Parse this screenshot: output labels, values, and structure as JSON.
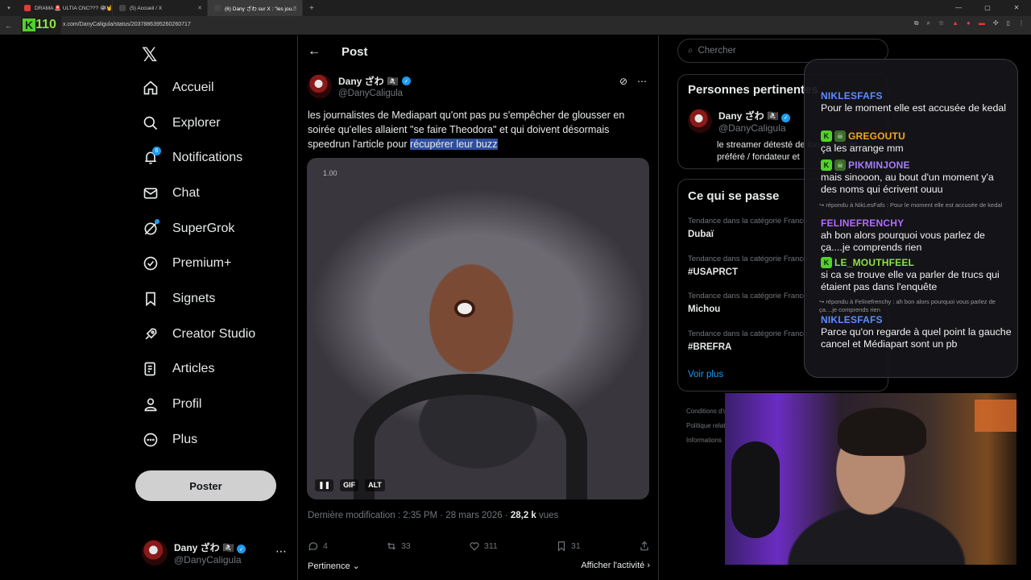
{
  "browser": {
    "tabs": [
      {
        "title": "DRAMA 🚨 ULTIA CNC??? 😭🤘",
        "favicon_color": "#e53935",
        "active": false
      },
      {
        "title": "(5) Accueil / X",
        "favicon_color": "#222222",
        "active": false
      },
      {
        "title": "(6) Dany ざわ sur X : \"les jou...",
        "favicon_color": "#222222",
        "active": true
      }
    ],
    "url": "x.com/DanyCaligula/status/2037886395260260717",
    "logo_text": "110"
  },
  "nav": {
    "items": [
      {
        "label": "Accueil",
        "icon": "home-icon"
      },
      {
        "label": "Explorer",
        "icon": "search-icon"
      },
      {
        "label": "Notifications",
        "icon": "bell-icon",
        "badge": "6"
      },
      {
        "label": "Chat",
        "icon": "mail-icon"
      },
      {
        "label": "SuperGrok",
        "icon": "grok-icon"
      },
      {
        "label": "Premium+",
        "icon": "verified-icon"
      },
      {
        "label": "Signets",
        "icon": "bookmark-icon"
      },
      {
        "label": "Creator Studio",
        "icon": "rocket-icon"
      },
      {
        "label": "Articles",
        "icon": "article-icon"
      },
      {
        "label": "Profil",
        "icon": "person-icon"
      },
      {
        "label": "Plus",
        "icon": "more-circle-icon"
      }
    ],
    "post_button": "Poster",
    "account": {
      "name": "Dany ざわ 🏴‍☠️",
      "handle": "@DanyCaligula"
    }
  },
  "post": {
    "header": "Post",
    "author": {
      "name": "Dany ざわ 🏴‍☠️",
      "handle": "@DanyCaligula"
    },
    "text_before": "les journalistes de Mediapart qu'ont pas pu s'empêcher de glousser en soirée qu'elles allaient \"se faire Theodora\" et qui doivent désormais speedrun l'article pour ",
    "text_highlight": "récupérer leur buzz",
    "media": {
      "speed": "1.00",
      "controls": [
        "GIF",
        "ALT"
      ]
    },
    "meta_prefix": "Dernière modification : 2:35 PM · 28 mars 2026 · ",
    "views": "28,2 k",
    "views_label": "vues",
    "stats": {
      "replies": "4",
      "reposts": "33",
      "likes": "311",
      "bookmarks": "31"
    },
    "sort_label": "Pertinence",
    "activity_label": "Afficher l'activité"
  },
  "sidebar": {
    "search_placeholder": "Chercher",
    "relevant": {
      "title": "Personnes pertinentes",
      "user_name": "Dany ざわ 🏴‍☠️",
      "user_handle": "@DanyCaligula",
      "bio": "le streamer détesté de ton streamer préféré / fondateur et"
    },
    "happening": {
      "title": "Ce qui se passe",
      "trends": [
        {
          "category": "Tendance dans la catégorie France",
          "tag": "Dubaï"
        },
        {
          "category": "Tendance dans la catégorie France",
          "tag": "#USAPRCT"
        },
        {
          "category": "Tendance dans la catégorie France",
          "tag": "Michou"
        },
        {
          "category": "Tendance dans la catégorie France",
          "tag": "#BREFRA"
        }
      ],
      "more": "Voir plus"
    },
    "footer": [
      "Conditions d'utilisation",
      "Politique relative",
      "Informations"
    ]
  },
  "chat": {
    "messages": [
      {
        "user": "NIKLESFAFS",
        "color": "#5f8cff",
        "badges": [],
        "body": "Pour le moment elle est accusée de kedal"
      },
      {
        "user": "GREGOUTU",
        "color": "#f5a623",
        "badges": [
          "K",
          "skull"
        ],
        "body": "ça les arrange mm"
      },
      {
        "user": "PIKMINJONE",
        "color": "#a57cff",
        "badges": [
          "K",
          "skull"
        ],
        "body": "mais sinooon, au bout d'un moment y'a des noms qui écrivent ouuu"
      },
      {
        "user": "FELINEFRENCHY",
        "color": "#b36bff",
        "badges": [],
        "reply": "↪ répondu à NikLesFafs : Pour le moment elle est accusée de kedal",
        "body": "ah bon alors pourquoi vous parlez de ça....je comprends rien"
      },
      {
        "user": "LE_MOUTHFEEL",
        "color": "#8fe04a",
        "badges": [
          "K"
        ],
        "body": "si ca se trouve elle va parler de trucs qui étaient pas dans l'enquête"
      },
      {
        "user": "NIKLESFAFS",
        "color": "#5f8cff",
        "badges": [],
        "reply": "↪ répondu à Felinefrenchy : ah bon alors pourquoi vous parlez de ça....je comprends rien",
        "body": "Parce qu'on regarde à quel point la gauche cancel et Médiapart sont un pb"
      }
    ]
  }
}
